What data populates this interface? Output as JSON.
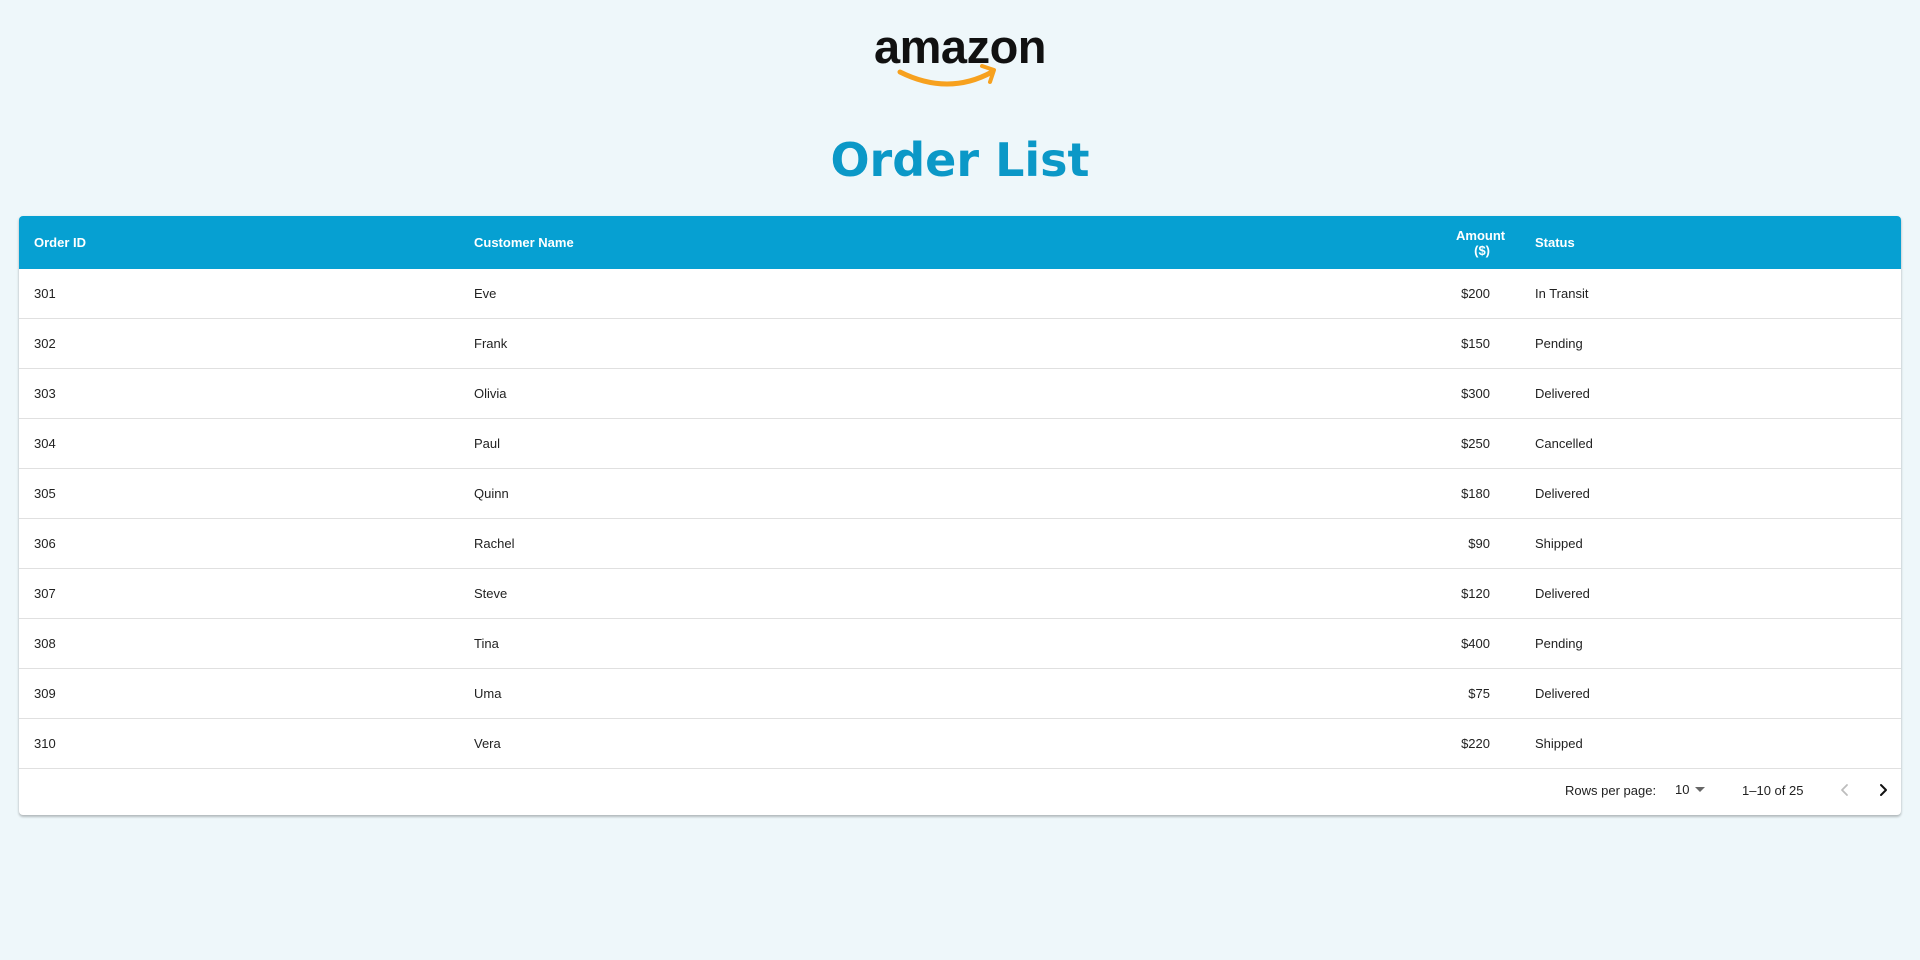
{
  "brand": {
    "logo_text": "amazon",
    "accent_color": "#f7a11e",
    "primary_color": "#06a0d2",
    "title_color": "#0b98c7"
  },
  "page_title": "Order List",
  "table": {
    "columns": [
      "Order ID",
      "Customer Name",
      "Amount ($)",
      "Status"
    ],
    "rows": [
      {
        "id": "301",
        "name": "Eve",
        "amount": "$200",
        "status": "In Transit"
      },
      {
        "id": "302",
        "name": "Frank",
        "amount": "$150",
        "status": "Pending"
      },
      {
        "id": "303",
        "name": "Olivia",
        "amount": "$300",
        "status": "Delivered"
      },
      {
        "id": "304",
        "name": "Paul",
        "amount": "$250",
        "status": "Cancelled"
      },
      {
        "id": "305",
        "name": "Quinn",
        "amount": "$180",
        "status": "Delivered"
      },
      {
        "id": "306",
        "name": "Rachel",
        "amount": "$90",
        "status": "Shipped"
      },
      {
        "id": "307",
        "name": "Steve",
        "amount": "$120",
        "status": "Delivered"
      },
      {
        "id": "308",
        "name": "Tina",
        "amount": "$400",
        "status": "Pending"
      },
      {
        "id": "309",
        "name": "Uma",
        "amount": "$75",
        "status": "Delivered"
      },
      {
        "id": "310",
        "name": "Vera",
        "amount": "$220",
        "status": "Shipped"
      }
    ]
  },
  "pagination": {
    "rows_per_page_label": "Rows per page:",
    "rows_per_page_value": "10",
    "range_label": "1–10 of 25",
    "prev_icon": "chevron-left-icon",
    "next_icon": "chevron-right-icon"
  }
}
